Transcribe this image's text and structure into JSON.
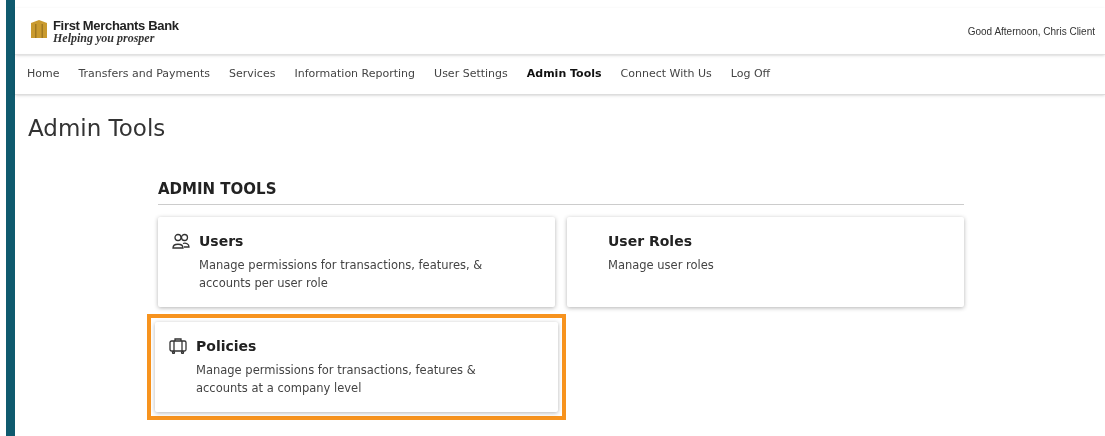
{
  "header": {
    "bank_name": "First Merchants Bank",
    "tagline": "Helping you prosper",
    "greeting": "Good Afternoon, Chris Client"
  },
  "nav": [
    {
      "label": "Home",
      "selected": false
    },
    {
      "label": "Transfers and Payments",
      "selected": false
    },
    {
      "label": "Services",
      "selected": false
    },
    {
      "label": "Information Reporting",
      "selected": false
    },
    {
      "label": "User Settings",
      "selected": false
    },
    {
      "label": "Admin Tools",
      "selected": true
    },
    {
      "label": "Connect With Us",
      "selected": false
    },
    {
      "label": "Log Off",
      "selected": false
    }
  ],
  "page_title": "Admin Tools",
  "section_heading": "ADMIN TOOLS",
  "cards": [
    {
      "kind": "users",
      "title": "Users",
      "description": "Manage permissions for transactions, features, & accounts per user role",
      "highlighted": false
    },
    {
      "kind": "plain",
      "title": "User Roles",
      "description": "Manage user roles",
      "highlighted": false
    },
    {
      "kind": "policy",
      "title": "Policies",
      "description": "Manage permissions for transactions, features & accounts at a company level",
      "highlighted": true
    }
  ]
}
